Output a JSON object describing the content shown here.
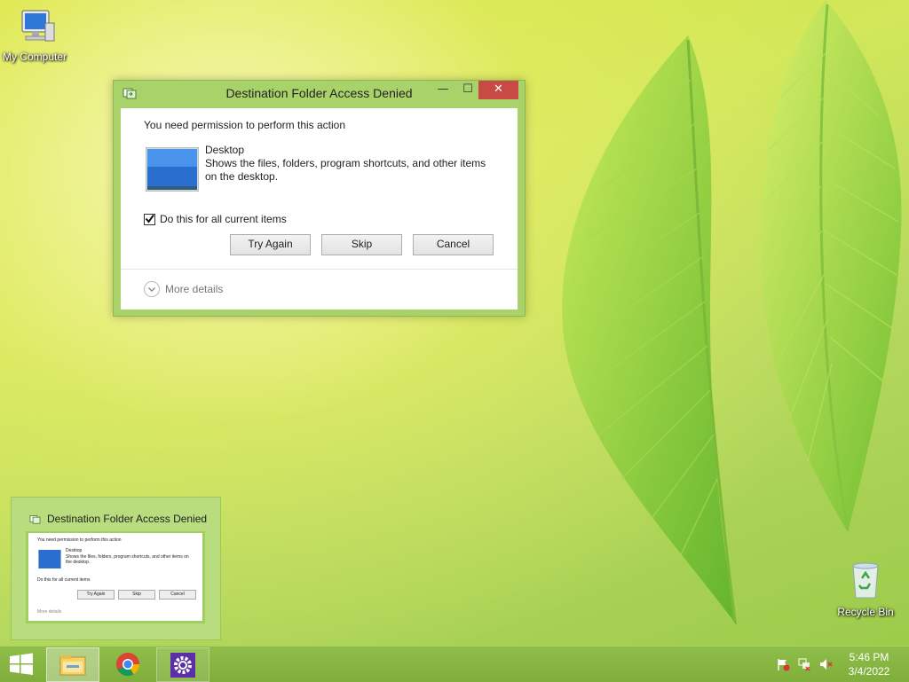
{
  "desktop": {
    "icons": [
      {
        "label": "My Computer",
        "icon": "computer-icon"
      },
      {
        "label": "Recycle Bin",
        "icon": "recycle-bin-icon"
      }
    ]
  },
  "dialog": {
    "title": "Destination Folder Access Denied",
    "controls": {
      "minimize": "—",
      "maximize": "☐",
      "close": "✕"
    },
    "message": "You need permission to perform this action",
    "folder": {
      "name": "Desktop",
      "description": "Shows the files, folders, program shortcuts, and other items on the desktop."
    },
    "checkbox": {
      "label": "Do this for all current items",
      "checked": true
    },
    "buttons": {
      "try_again": "Try Again",
      "skip": "Skip",
      "cancel": "Cancel"
    },
    "more_details": "More details"
  },
  "preview": {
    "title": "Destination Folder Access Denied"
  },
  "taskbar": {
    "items": [
      "start-button",
      "file-explorer-icon",
      "chrome-icon",
      "settings-icon"
    ],
    "tray": {
      "time": "5:46 PM",
      "date": "3/4/2022"
    }
  },
  "colors": {
    "dialog_frame": "#a9d36a",
    "close_button": "#c94a45",
    "taskbar": "#87b542"
  }
}
